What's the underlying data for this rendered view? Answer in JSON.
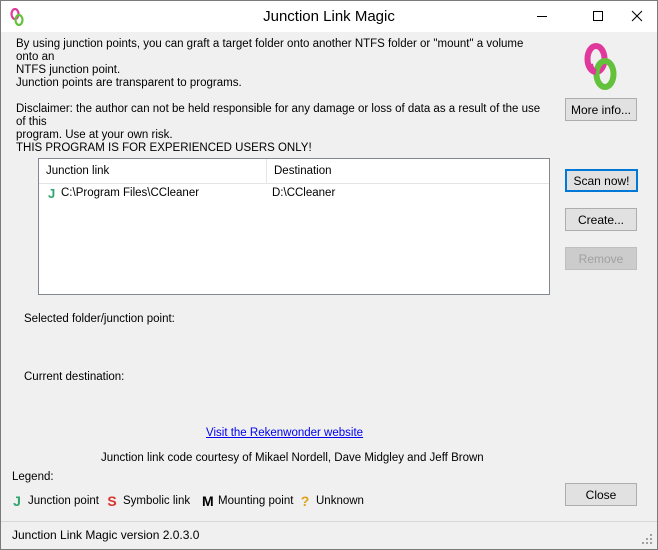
{
  "window": {
    "title": "Junction Link Magic"
  },
  "intro": {
    "line1": "By using junction points, you can graft a target folder onto another NTFS folder or \"mount\" a volume onto an",
    "line2": "NTFS junction point.",
    "line3": "Junction points are transparent to programs.",
    "line4": "Disclaimer: the author can not be held responsible for any damage or loss of data as a result of the use of this",
    "line5": "program. Use at your own risk.",
    "line6": "THIS PROGRAM IS FOR EXPERIENCED USERS ONLY!"
  },
  "buttons": {
    "more_info": "More info...",
    "scan_now": "Scan now!",
    "create": "Create...",
    "remove": "Remove",
    "close": "Close"
  },
  "list": {
    "columns": [
      "Junction link",
      "Destination"
    ],
    "rows": [
      {
        "icon": "J",
        "type": "junction-point",
        "link": "C:\\Program Files\\CCleaner",
        "destination": "D:\\CCleaner"
      }
    ]
  },
  "details": {
    "selected_label": "Selected folder/junction point:",
    "current_label": "Current destination:"
  },
  "website_link": "Visit the Rekenwonder website",
  "credits": "Junction link code courtesy of Mikael Nordell, Dave Midgley and Jeff Brown",
  "legend": {
    "title": "Legend:",
    "items": [
      {
        "glyph": "J",
        "label": "Junction point",
        "color": "#2fa56f"
      },
      {
        "glyph": "S",
        "label": "Symbolic link",
        "color": "#d9342b"
      },
      {
        "glyph": "M",
        "label": "Mounting point",
        "color": "#000000"
      },
      {
        "glyph": "?",
        "label": "Unknown",
        "color": "#e0a21a"
      }
    ]
  },
  "status": {
    "text": "Junction Link Magic version 2.0.3.0"
  },
  "colors": {
    "accent": "#0078d7",
    "link": "#0000ee",
    "logo_pink": "#e0399b",
    "logo_green": "#63c13b"
  }
}
